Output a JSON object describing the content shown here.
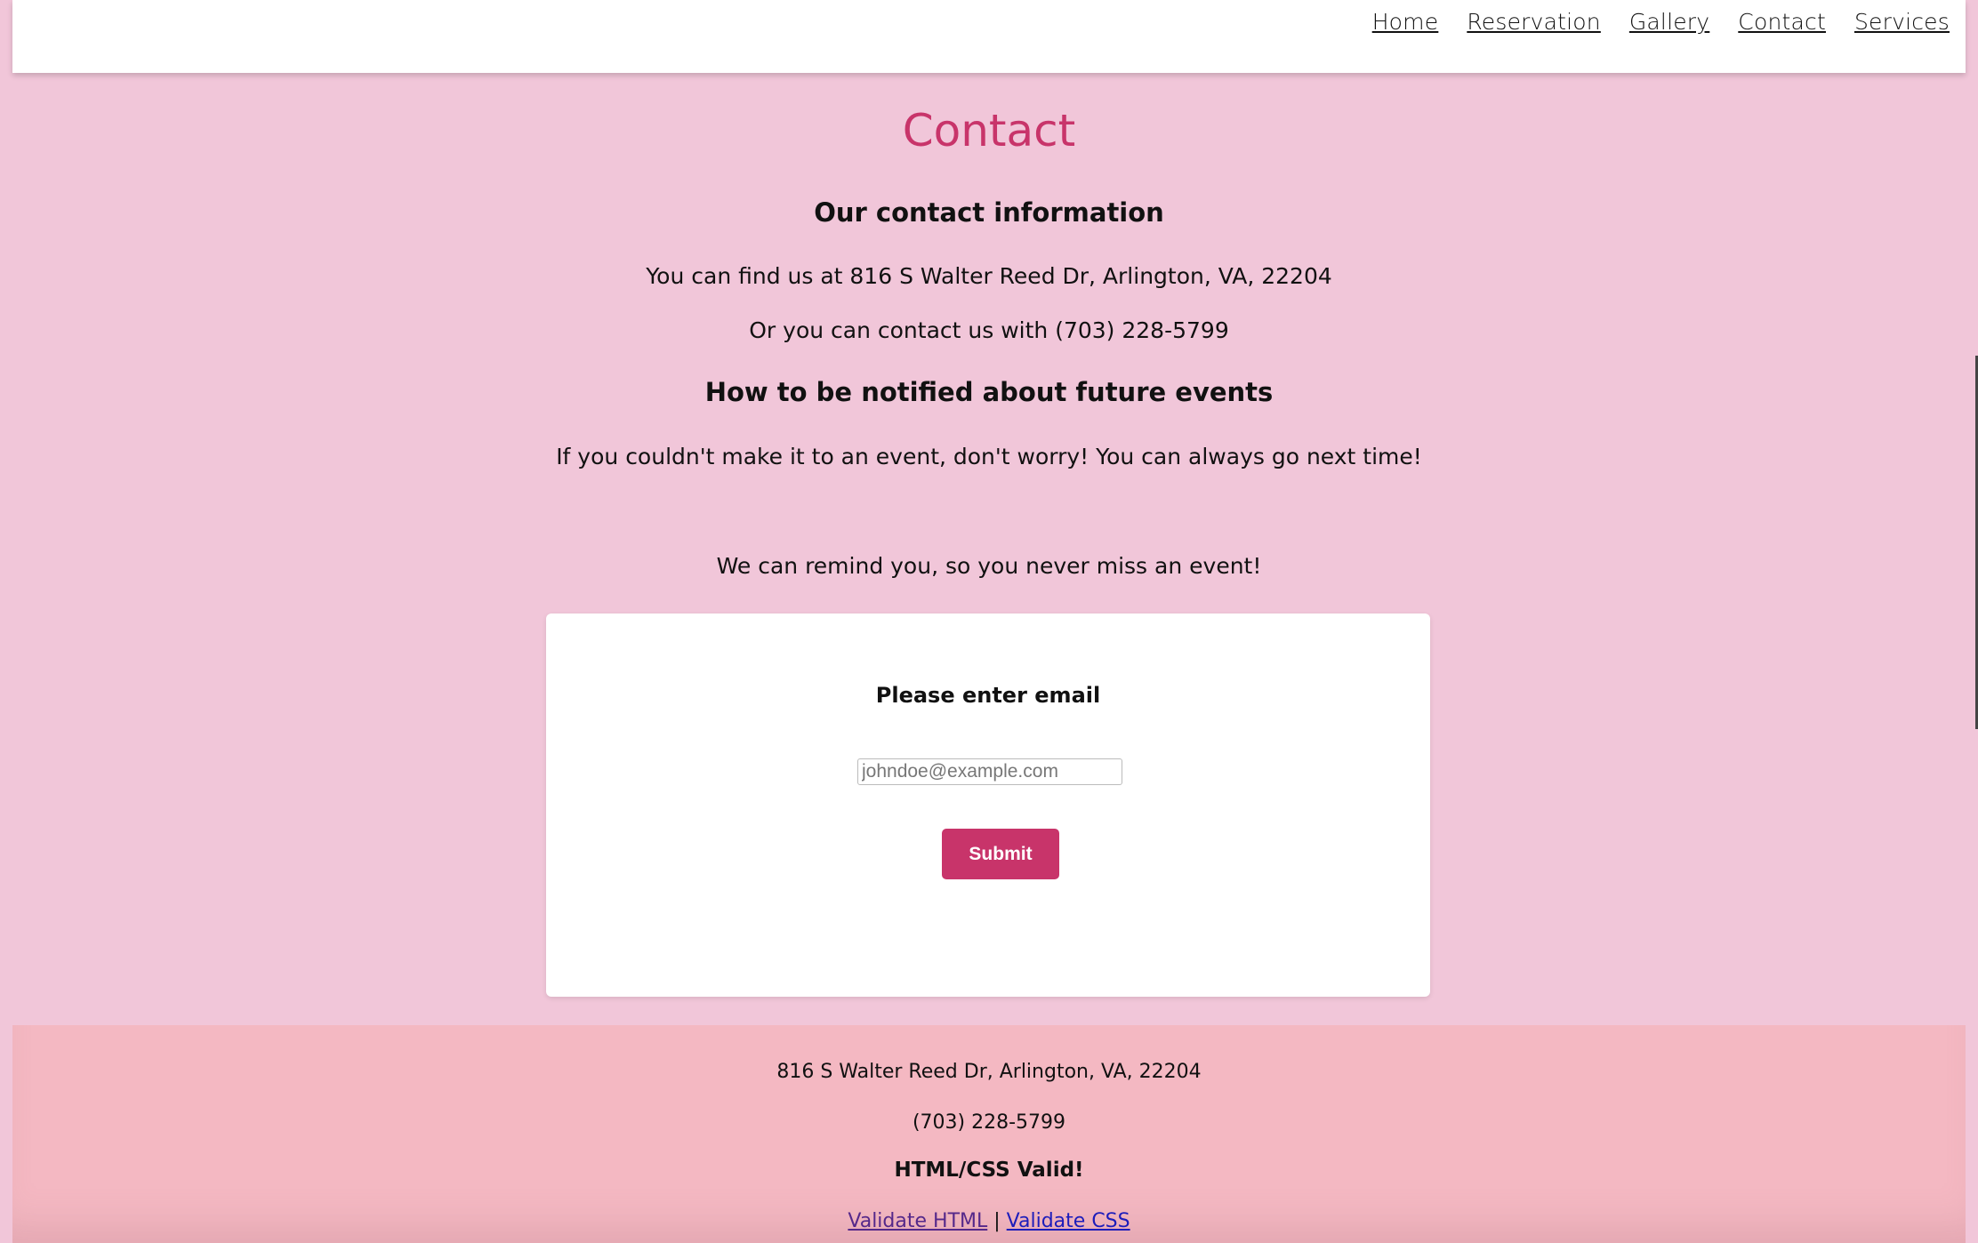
{
  "nav": {
    "items": [
      "Home",
      "Reservation",
      "Gallery",
      "Contact",
      "Services"
    ]
  },
  "page": {
    "title": "Contact",
    "contact_heading": "Our contact information",
    "address_line": "You can find us at 816 S Walter Reed Dr, Arlington, VA, 22204",
    "phone_line": "Or you can contact us with (703) 228-5799",
    "notify_heading": "How to be notified about future events",
    "notify_text": "If you couldn't make it to an event, don't worry! You can always go next time!",
    "remind_text": "We can remind you, so you never miss an event!"
  },
  "form": {
    "label": "Please enter email",
    "email_placeholder": "johndoe@example.com",
    "email_value": "",
    "submit_label": "Submit"
  },
  "footer": {
    "address": "816 S Walter Reed Dr, Arlington, VA, 22204",
    "phone": "(703) 228-5799",
    "valid_text": "HTML/CSS Valid!",
    "validate_html": "Validate HTML",
    "separator": "|",
    "validate_css": "Validate CSS"
  },
  "colors": {
    "background": "#f1c6d9",
    "accent": "#c8346a",
    "footer_bg": "#f4b8c2",
    "card_bg": "#ffffff"
  }
}
